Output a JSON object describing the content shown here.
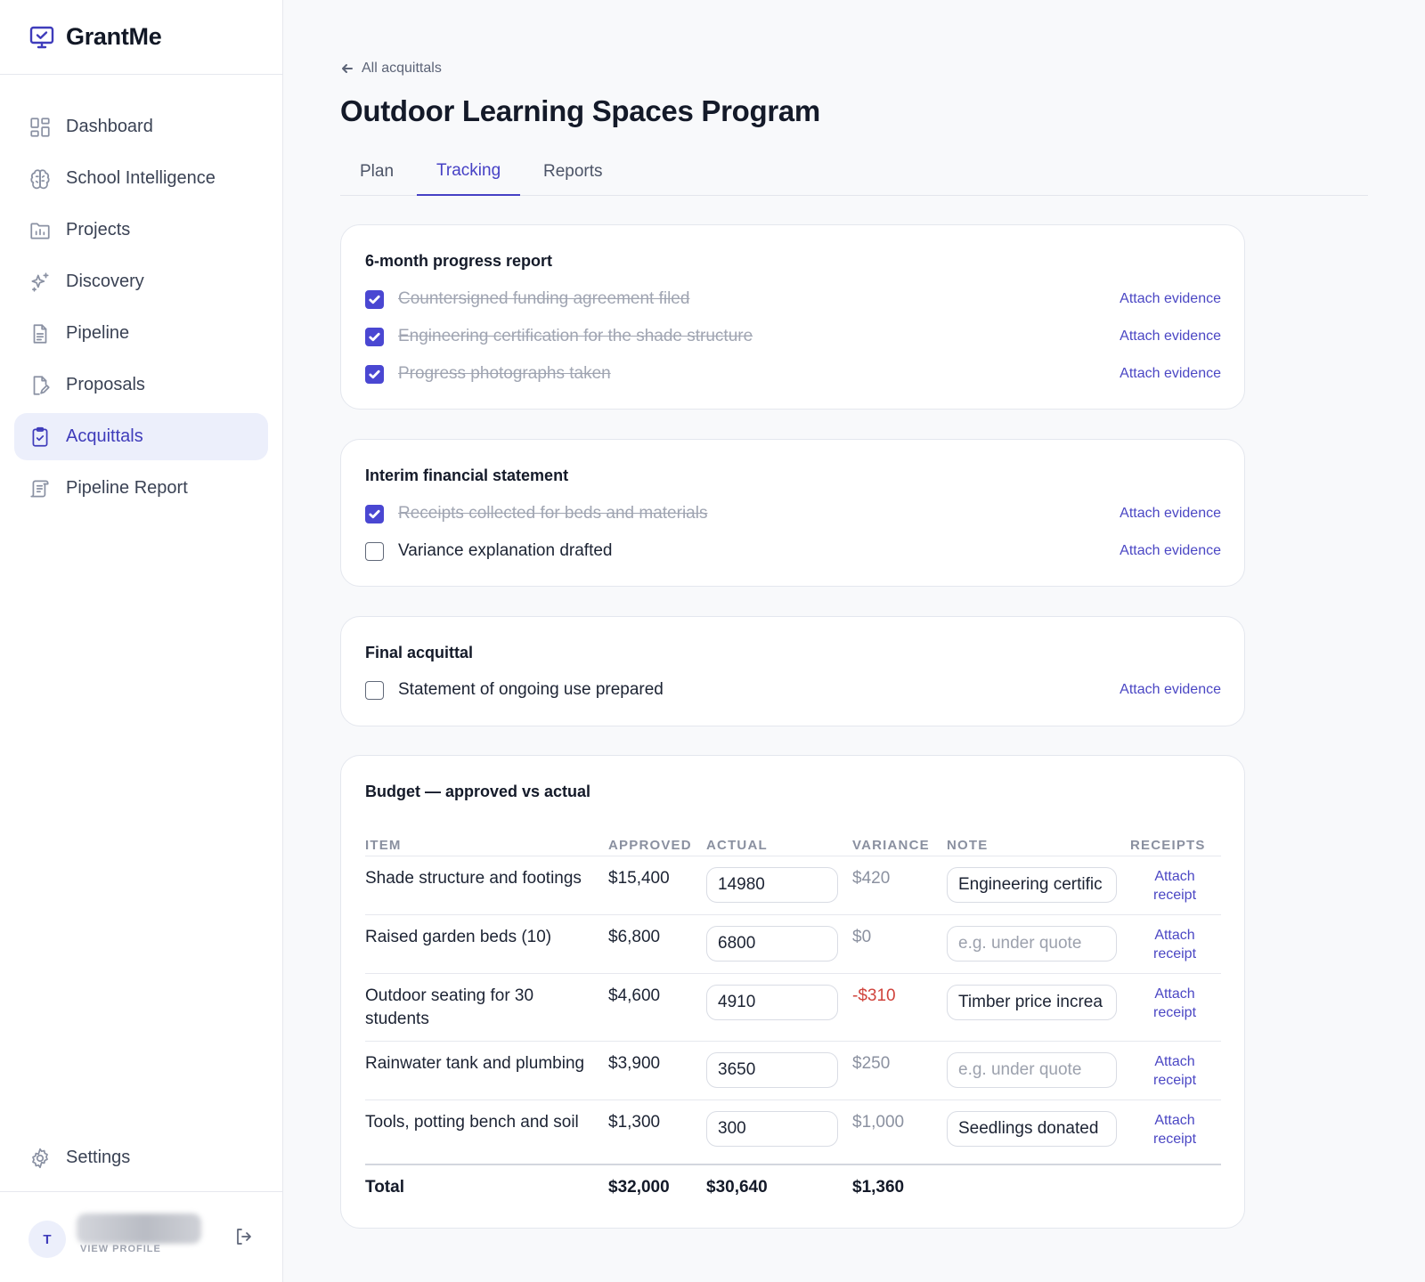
{
  "app": {
    "name": "GrantMe"
  },
  "sidebar": {
    "items": [
      {
        "label": "Dashboard",
        "icon": "dashboard-icon"
      },
      {
        "label": "School Intelligence",
        "icon": "brain-icon"
      },
      {
        "label": "Projects",
        "icon": "folder-chart-icon"
      },
      {
        "label": "Discovery",
        "icon": "sparkles-icon"
      },
      {
        "label": "Pipeline",
        "icon": "document-icon"
      },
      {
        "label": "Proposals",
        "icon": "document-edit-icon"
      },
      {
        "label": "Acquittals",
        "icon": "clipboard-check-icon",
        "active": true
      },
      {
        "label": "Pipeline Report",
        "icon": "scroll-icon"
      }
    ],
    "settings_label": "Settings",
    "profile": {
      "initial": "T",
      "link": "VIEW PROFILE"
    }
  },
  "header": {
    "back_label": "All acquittals",
    "title": "Outdoor Learning Spaces Program",
    "tabs": [
      {
        "label": "Plan"
      },
      {
        "label": "Tracking",
        "active": true
      },
      {
        "label": "Reports"
      }
    ]
  },
  "sections": [
    {
      "title": "6-month progress report",
      "items": [
        {
          "label": "Countersigned funding agreement filed",
          "checked": true,
          "action": "Attach evidence"
        },
        {
          "label": "Engineering certification for the shade structure",
          "checked": true,
          "action": "Attach evidence"
        },
        {
          "label": "Progress photographs taken",
          "checked": true,
          "action": "Attach evidence"
        }
      ]
    },
    {
      "title": "Interim financial statement",
      "items": [
        {
          "label": "Receipts collected for beds and materials",
          "checked": true,
          "action": "Attach evidence"
        },
        {
          "label": "Variance explanation drafted",
          "checked": false,
          "action": "Attach evidence"
        }
      ]
    },
    {
      "title": "Final acquittal",
      "items": [
        {
          "label": "Statement of ongoing use prepared",
          "checked": false,
          "action": "Attach evidence"
        }
      ]
    }
  ],
  "budget": {
    "title": "Budget — approved vs actual",
    "columns": [
      "ITEM",
      "APPROVED",
      "ACTUAL",
      "VARIANCE",
      "NOTE",
      "RECEIPTS"
    ],
    "rows": [
      {
        "item": "Shade structure and footings",
        "approved": "$15,400",
        "actual": "14980",
        "variance": "$420",
        "note": "Engineering certific",
        "note_placeholder": "e.g. under quote",
        "receipt": "Attach receipt"
      },
      {
        "item": "Raised garden beds (10)",
        "approved": "$6,800",
        "actual": "6800",
        "variance": "$0",
        "note": "",
        "note_placeholder": "e.g. under quote",
        "receipt": "Attach receipt"
      },
      {
        "item": "Outdoor seating for 30 students",
        "approved": "$4,600",
        "actual": "4910",
        "variance": "-$310",
        "note": "Timber price increa",
        "note_placeholder": "e.g. under quote",
        "receipt": "Attach receipt"
      },
      {
        "item": "Rainwater tank and plumbing",
        "approved": "$3,900",
        "actual": "3650",
        "variance": "$250",
        "note": "",
        "note_placeholder": "e.g. under quote",
        "receipt": "Attach receipt"
      },
      {
        "item": "Tools, potting bench and soil",
        "approved": "$1,300",
        "actual": "300",
        "variance": "$1,000",
        "note": "Seedlings donated",
        "note_placeholder": "e.g. under quote",
        "receipt": "Attach receipt"
      }
    ],
    "total": {
      "label": "Total",
      "approved": "$32,000",
      "actual": "$30,640",
      "variance": "$1,360"
    }
  },
  "colors": {
    "accent": "#4a47d2",
    "negative": "#d0433c",
    "active_bg": "#eceffb"
  }
}
